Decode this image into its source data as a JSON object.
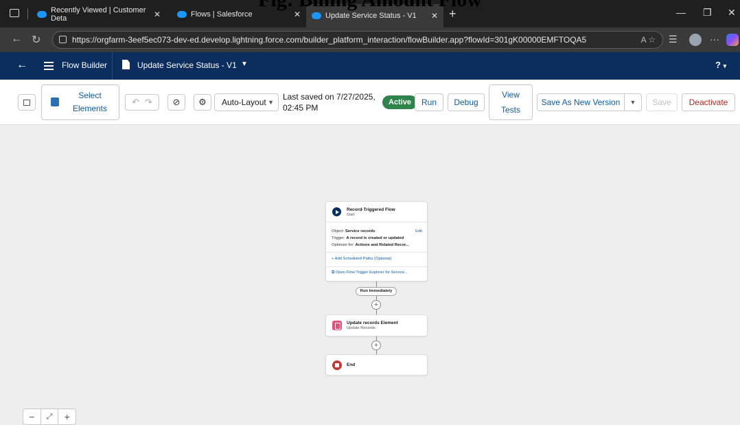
{
  "caption": "Fig: Billing Amount Flow",
  "browser": {
    "tabs": [
      {
        "label": "Recently Viewed | Customer Deta"
      },
      {
        "label": "Flows | Salesforce"
      },
      {
        "label": "Update Service Status - V1"
      }
    ],
    "url": "https://orgfarm-3eef5ec073-dev-ed.develop.lightning.force.com/builder_platform_interaction/flowBuilder.app?flowId=301gK00000EMFTOQA5"
  },
  "header": {
    "app_label": "Flow Builder",
    "flow_title": "Update Service Status - V1",
    "help": "?"
  },
  "toolbar": {
    "select_elements": "Select Elements",
    "layout_mode": "Auto-Layout",
    "saved_line1": "Last saved on 7/27/2025,",
    "saved_line2": "02:45 PM",
    "status": "Active",
    "run": "Run",
    "debug": "Debug",
    "view_tests_1": "View",
    "view_tests_2": "Tests",
    "save_as_new": "Save As New Version",
    "save": "Save",
    "deactivate": "Deactivate"
  },
  "canvas": {
    "start": {
      "title": "Record-Triggered Flow",
      "subtitle": "Start",
      "object_label": "Object:",
      "object_value": "Service records",
      "edit": "Edit",
      "trigger_label": "Trigger:",
      "trigger_value": "A record is created or updated",
      "optimize_label": "Optimize for:",
      "optimize_value": "Actions and Related Recor...",
      "add_paths": "+ Add Scheduled Paths (Optional)",
      "open_explorer": "Open Flow Trigger Explorer for Service..."
    },
    "path_label": "Run Immediately",
    "update": {
      "title": "Update records Element",
      "subtitle": "Update Records"
    },
    "end": {
      "title": "End"
    }
  },
  "colors": {
    "header_bg": "#0b2e5e",
    "active_badge": "#2e844a",
    "deactivate_text": "#b3261e",
    "update_icon": "#e3507a",
    "end_icon": "#c23934"
  }
}
